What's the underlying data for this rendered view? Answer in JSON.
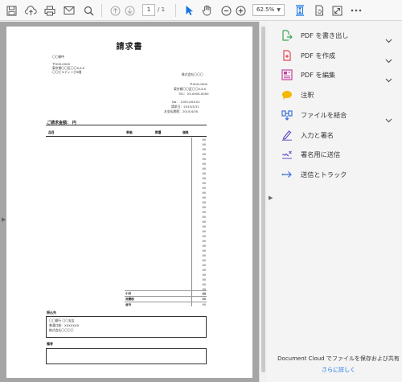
{
  "toolbar": {
    "page_current": "1",
    "page_total": "/ 1",
    "zoom": "62.5%"
  },
  "document": {
    "title": "請求書",
    "recipient": "〇〇御中",
    "postal": "〒000-0000",
    "address1": "東京都〇〇区〇〇X-X-X",
    "address2": "〇〇ビルディング6階",
    "issuer_company": "株式会社〇〇〇",
    "issuer_postal": "〒000-0000",
    "issuer_address": "東京都〇〇区〇〇X-X-X",
    "issuer_tel": "TEL：03-0000-0000",
    "meta": [
      {
        "label": "No：",
        "value": "1205-XXX-01"
      },
      {
        "label": "請求日：",
        "value": "2015/3/31"
      },
      {
        "label": "お支払期限：",
        "value": "2015/4/30"
      }
    ],
    "amount_label": "ご請求金額：  円",
    "table_headers": {
      "item": "品目",
      "unit_price": "単価",
      "qty": "数量",
      "amount": "価格"
    },
    "row_currency": "¥0",
    "totals": [
      {
        "label": "小計",
        "value": "¥0"
      },
      {
        "label": "消費税",
        "value": "¥0"
      },
      {
        "label": "合計",
        "value": "¥0"
      }
    ],
    "transfer_label": "振込先",
    "transfer_lines": [
      "〇〇銀行  〇〇支店",
      "普通口座：XXXXXXX",
      "株式会社〇〇〇〇"
    ],
    "notes_label": "備考"
  },
  "right_panel": {
    "tools": [
      {
        "label": "PDF を書き出し",
        "icon": "export-pdf-icon",
        "color": "#3aa856",
        "chevron": true
      },
      {
        "label": "PDF を作成",
        "icon": "create-pdf-icon",
        "color": "#e34850",
        "chevron": true
      },
      {
        "label": "PDF を編集",
        "icon": "edit-pdf-icon",
        "color": "#c4429e",
        "chevron": true
      },
      {
        "label": "注釈",
        "icon": "comment-icon",
        "color": "#f5b800",
        "chevron": false
      },
      {
        "label": "ファイルを結合",
        "icon": "combine-files-icon",
        "color": "#3a6fd8",
        "chevron": true
      },
      {
        "label": "入力と署名",
        "icon": "fill-sign-icon",
        "color": "#6a4fc6",
        "chevron": false
      },
      {
        "label": "署名用に送信",
        "icon": "send-for-signature-icon",
        "color": "#6a4fc6",
        "chevron": false
      },
      {
        "label": "送信とトラック",
        "icon": "send-track-icon",
        "color": "#3a6fd8",
        "chevron": false
      }
    ],
    "footer_text": "Document Cloud でファイルを保存および共有",
    "footer_link": "さらに詳しく"
  }
}
